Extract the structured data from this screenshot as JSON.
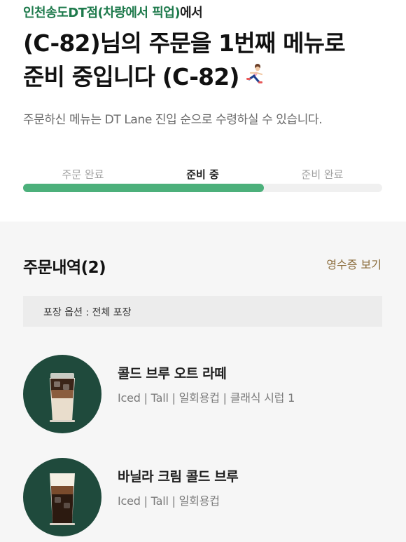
{
  "header": {
    "store_name": "인천송도DT점(차량에서 픽업)",
    "store_suffix": "에서",
    "headline_line1": " (C-82)님의 주문을 1번째 메뉴로",
    "headline_line2": "준비 중입니다 (C-82)",
    "runner_icon": "person-running-icon",
    "subtitle": "주문하신 메뉴는 DT Lane 진입 순으로 수령하실 수 있습니다."
  },
  "progress": {
    "steps": [
      "주문 완료",
      "준비 중",
      "준비 완료"
    ],
    "current_step": "준비 중",
    "fill_fraction": 0.67,
    "fill_color": "#4cb07b"
  },
  "order": {
    "title": "주문내역(2)",
    "receipt_link": "영수증 보기",
    "packaging": "포장 옵션 : 전체 포장",
    "items": [
      {
        "name": "콜드 브루 오트 라떼",
        "options": "Iced | Tall | 일회용컵 | 클래식 시럽 1"
      },
      {
        "name": "바닐라 크림 콜드 브루",
        "options": "Iced | Tall | 일회용컵"
      }
    ]
  },
  "colors": {
    "brand_green": "#1e7a4c",
    "accent_gold": "#8a6b3a",
    "thumb_bg": "#1f4a3c"
  }
}
